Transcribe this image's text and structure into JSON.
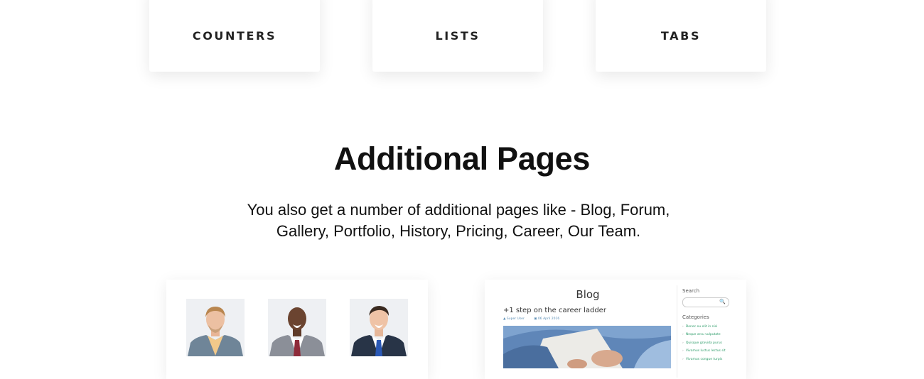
{
  "feature_cards": [
    {
      "label": "COUNTERS"
    },
    {
      "label": "LISTS"
    },
    {
      "label": "TABS"
    }
  ],
  "section": {
    "title": "Additional Pages",
    "description": "You also get a number of additional pages like - Blog, Forum, Gallery, Portfolio, History, Pricing, Career, Our Team."
  },
  "blog_preview": {
    "title": "Blog",
    "post_title": "+1 step on the career ladder",
    "post_author": "Super User",
    "post_date": "06 April 2016",
    "search_label": "Search",
    "search_icon": "magnifier",
    "categories_label": "Categories",
    "categories": [
      "Donec eu elit in nisi",
      "Neque arcu vulputate",
      "Quisque gravida purus",
      "Vivamus luctus lectus sit",
      "Vivamus congue turpis"
    ]
  },
  "colors": {
    "accent_blue": "#3b82d6",
    "category_link": "#2e9c6a",
    "meta_link": "#5a8db4"
  }
}
